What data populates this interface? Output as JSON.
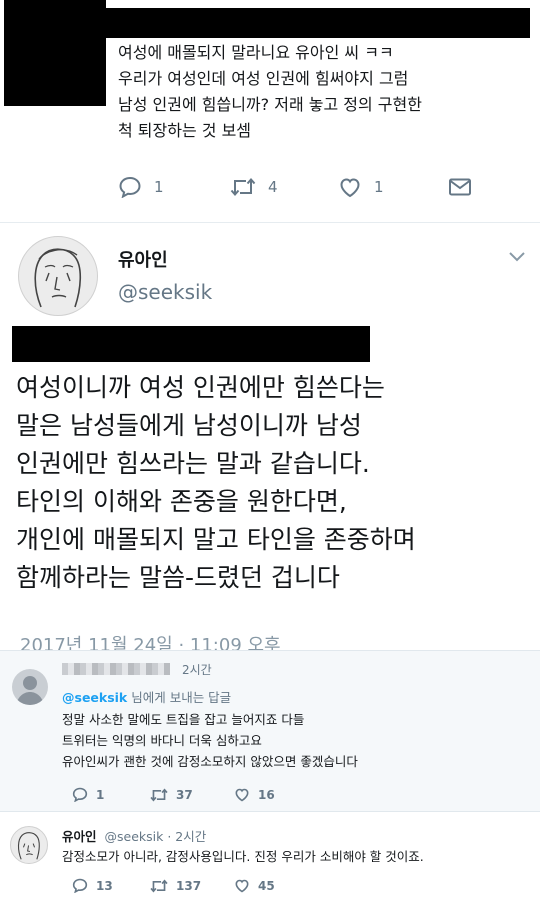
{
  "top_tweet": {
    "lines": [
      "여성에 매몰되지 말라니요 유아인 씨 ㅋㅋ",
      "우리가 여성인데 여성 인권에 힘써야지 그럼",
      "남성 인권에 힘씁니까? 저래 놓고 정의 구현한",
      "척 퇴장하는 것 보셈"
    ],
    "reply_count": "1",
    "retweet_count": "4",
    "like_count": "1"
  },
  "main_tweet": {
    "author_name": "유아인",
    "author_handle": "@seeksik",
    "lines": [
      "여성이니까 여성 인권에만 힘쓴다는",
      "말은 남성들에게 남성이니까 남성",
      "인권에만 힘쓰라는 말과 같습니다.",
      "타인의 이해와 존중을 원한다면,",
      "개인에 매몰되지 말고 타인을 존중하며",
      "함께하라는 말씀-드렸던 겁니다"
    ],
    "timestamp": "2017년 11월 24일 · 11:09 오후"
  },
  "reply_one": {
    "time": "2시간",
    "replying_handle": "@seeksik",
    "replying_suffix": " 님에게 보내는 답글",
    "lines": [
      "정말 사소한 말에도 트집을 잡고 늘어지죠 다들",
      "트위터는 익명의 바다니 더욱 심하고요",
      "유아인씨가 괜한 것에 감정소모하지 않았으면 좋겠습니다"
    ],
    "reply_count": "1",
    "retweet_count": "37",
    "like_count": "16"
  },
  "reply_two": {
    "author_name": "유아인",
    "author_meta": "@seeksik · 2시간",
    "text": "감정소모가 아니라, 감정사용입니다. 진정 우리가 소비해야 할 것이죠.",
    "reply_count": "13",
    "retweet_count": "137",
    "like_count": "45"
  }
}
